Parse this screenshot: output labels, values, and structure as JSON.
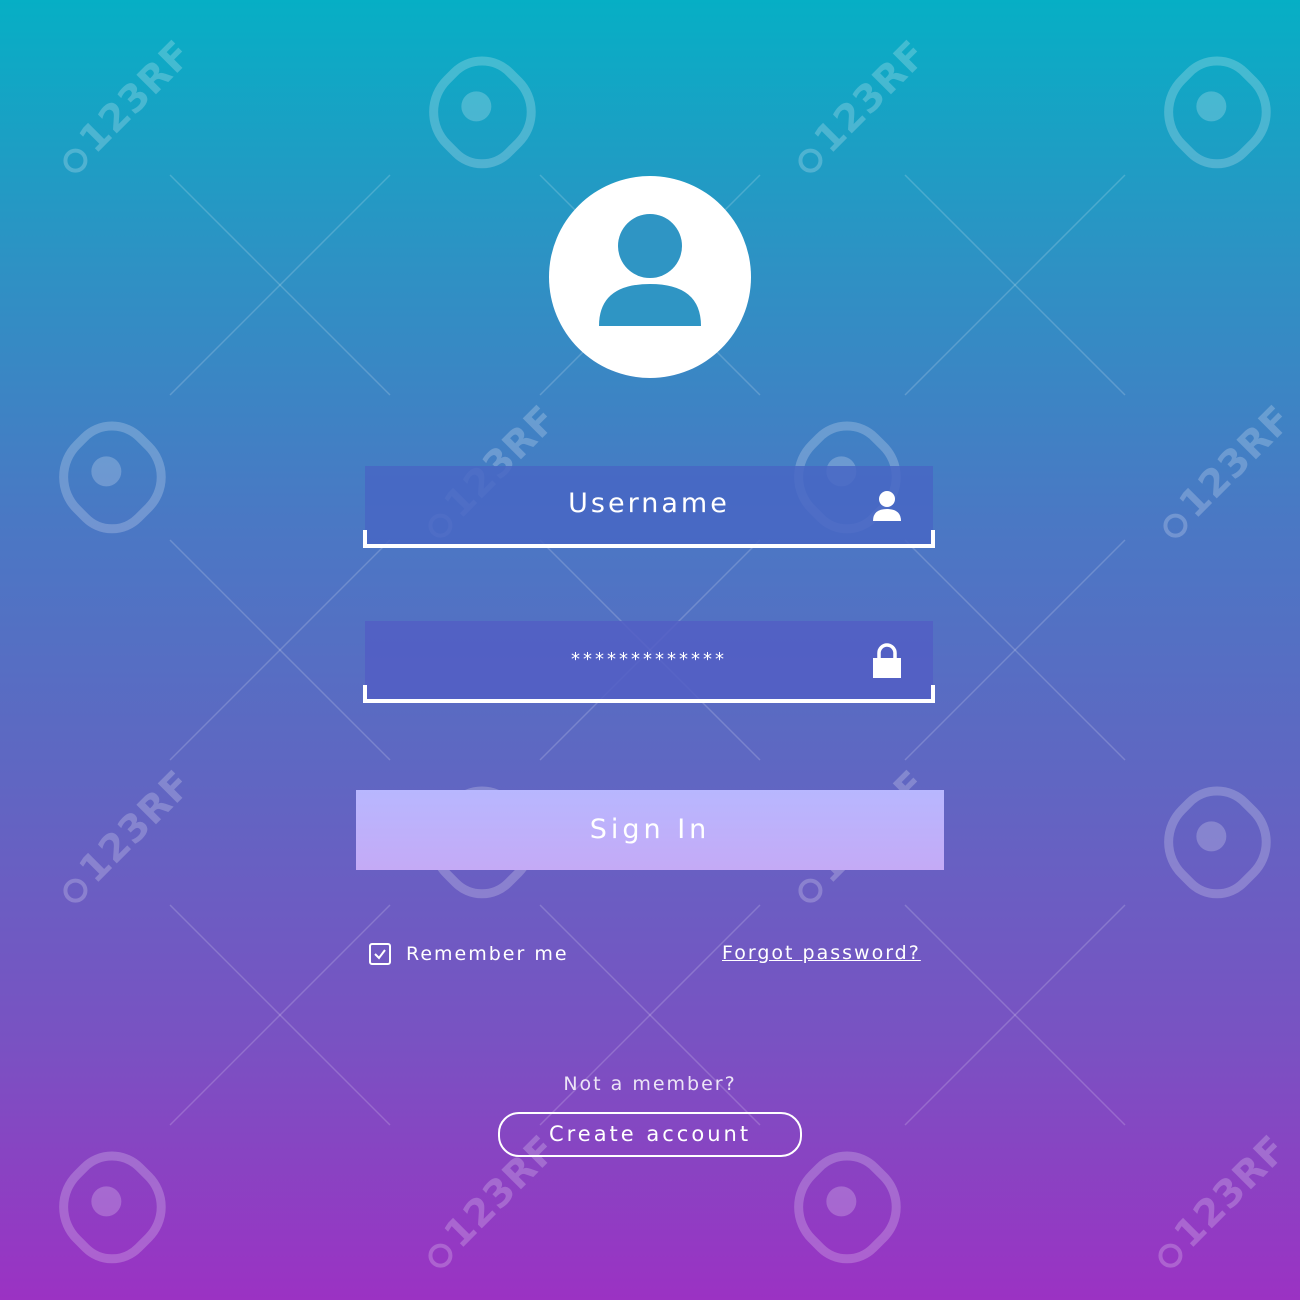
{
  "colors": {
    "gradient_top": "#06afc5",
    "gradient_bottom": "#9b32c3",
    "signin_button": "#b8b7ff",
    "text": "#ffffff"
  },
  "avatar": {
    "icon": "user-avatar-icon"
  },
  "username": {
    "label": "Username",
    "icon": "user-icon"
  },
  "password": {
    "value": "*************",
    "icon": "lock-icon"
  },
  "signin": {
    "label": "Sign In"
  },
  "remember": {
    "label": "Remember me",
    "checked": true
  },
  "forgot": {
    "label": "Forgot password?"
  },
  "signup": {
    "prompt": "Not a member?",
    "button_label": "Create account"
  },
  "watermark": {
    "text": "123RF"
  }
}
